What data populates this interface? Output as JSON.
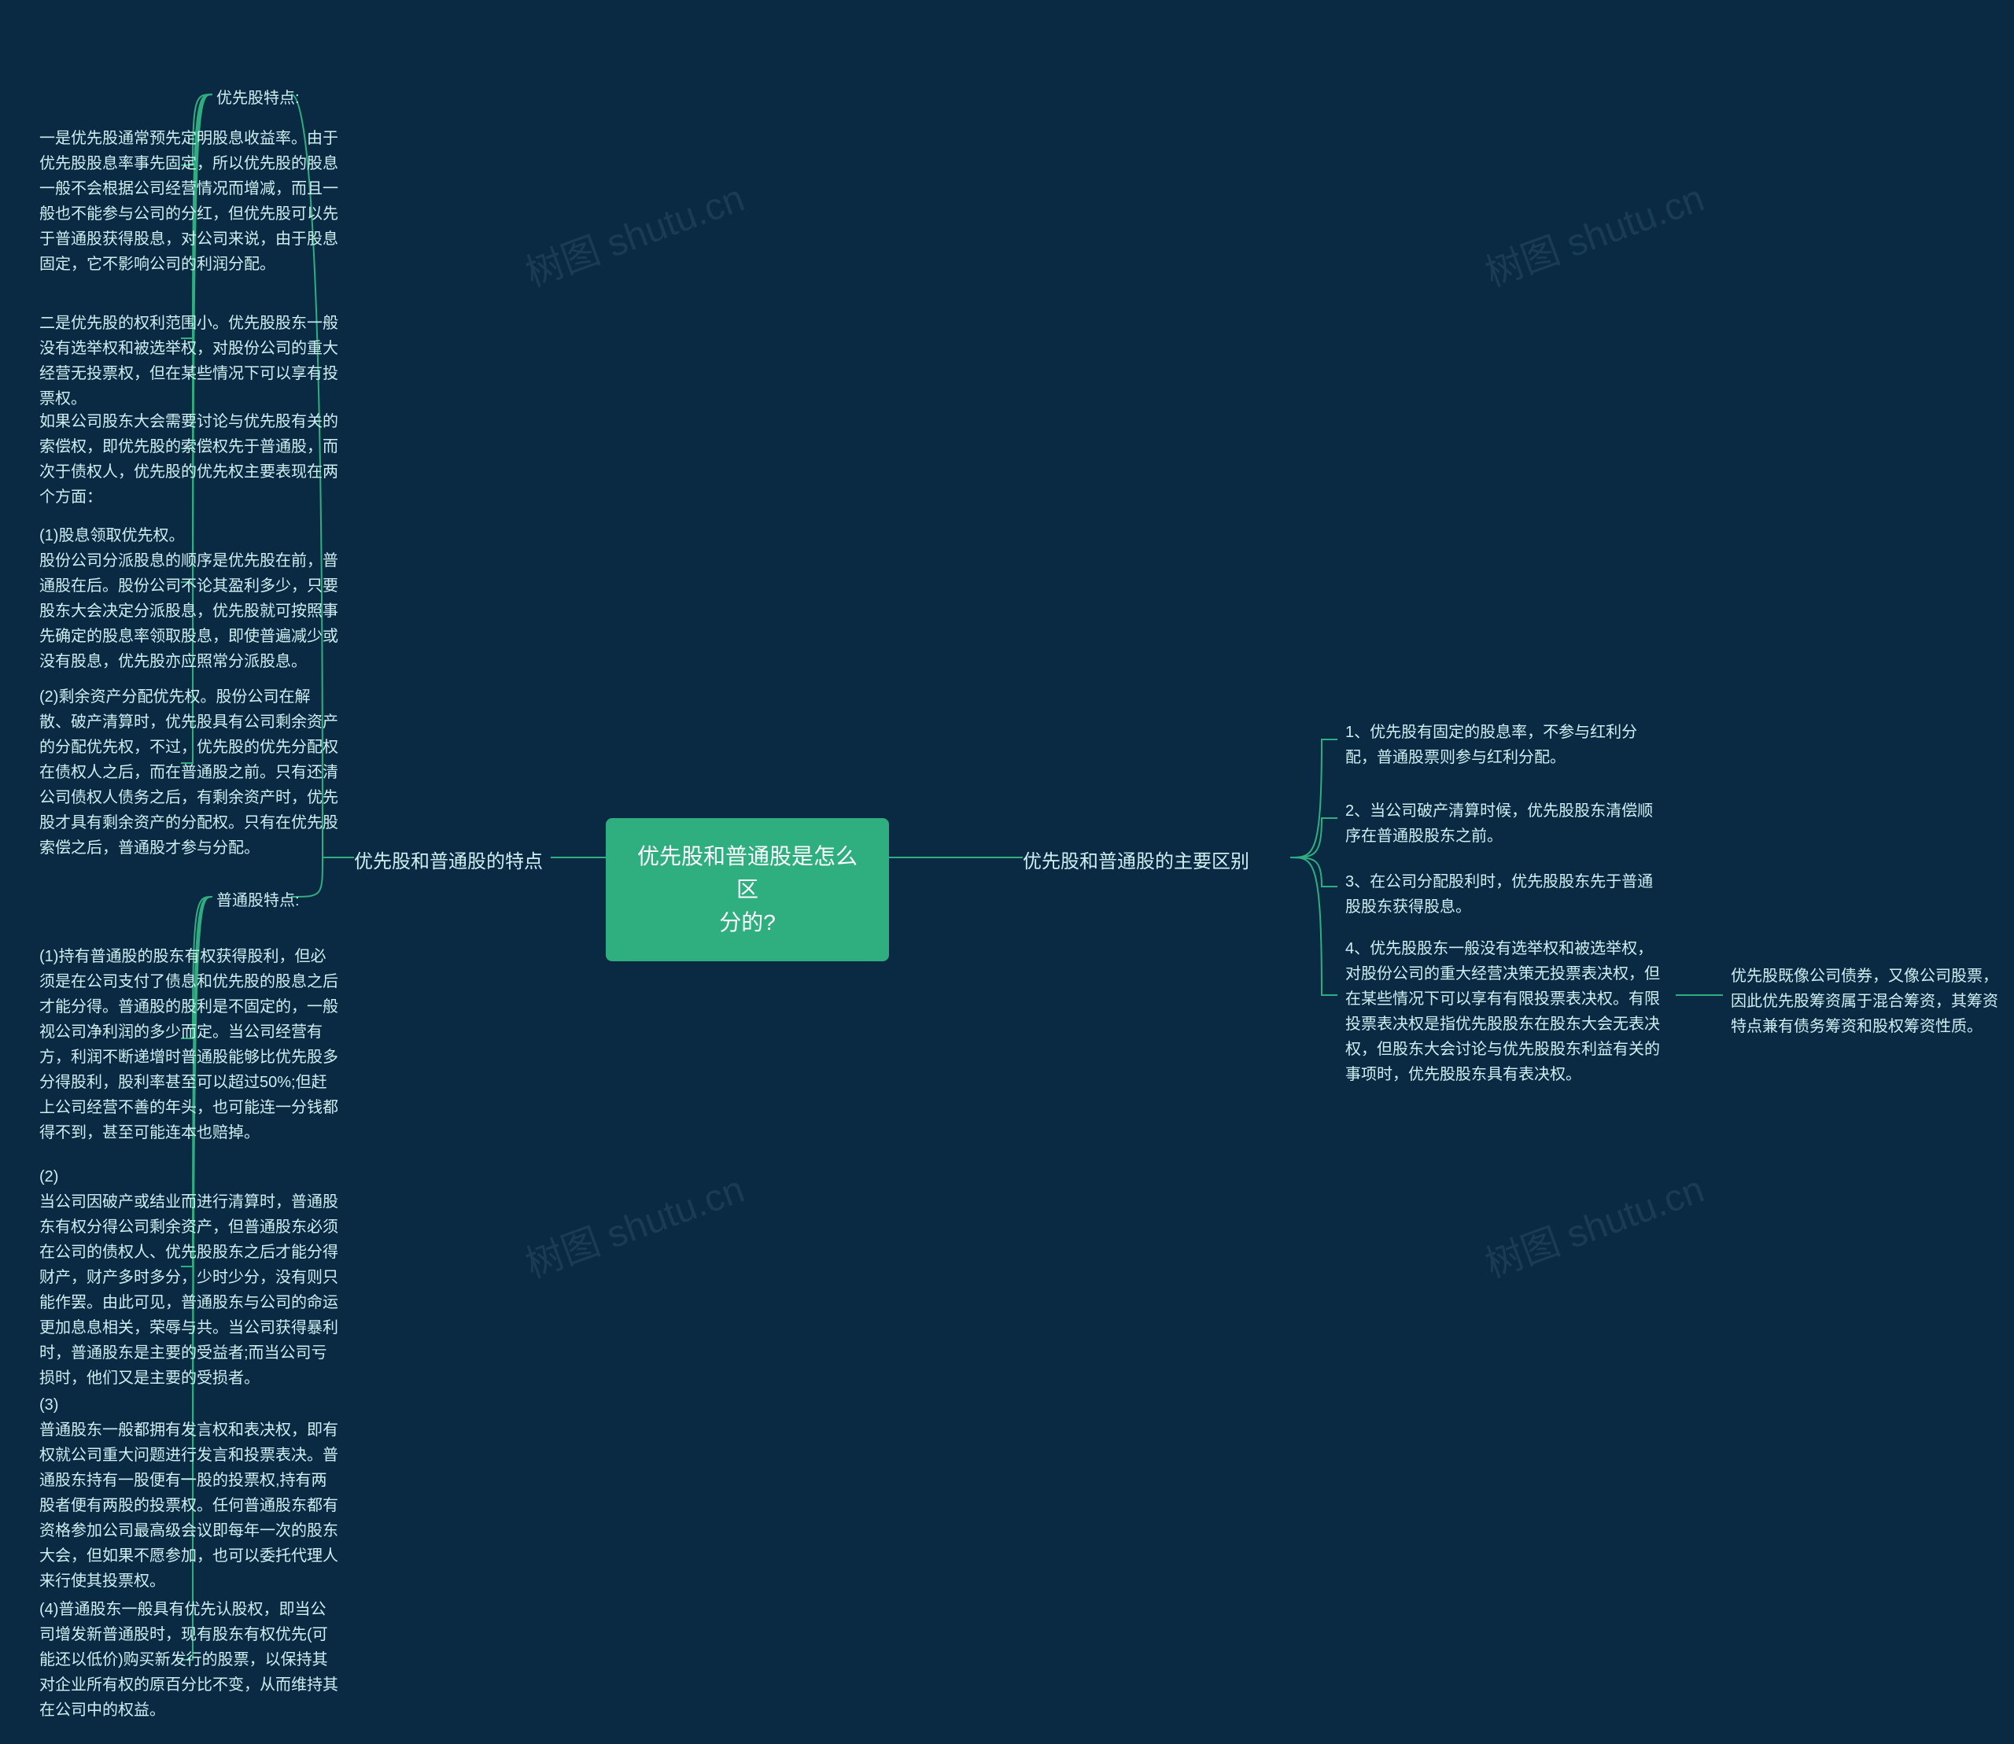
{
  "root": {
    "title": "优先股和普通股是怎么区\n分的?"
  },
  "watermarks": [
    "树图 shutu.cn",
    "树图 shutu.cn",
    "树图 shutu.cn",
    "树图 shutu.cn"
  ],
  "left_branch": {
    "label": "优先股和普通股的特点",
    "pref_label": "优先股特点:",
    "common_label": "普通股特点:",
    "pref_items": [
      "一是优先股通常预先定明股息收益率。由于优先股股息率事先固定，所以优先股的股息一般不会根据公司经营情况而增减，而且一般也不能参与公司的分红，但优先股可以先于普通股获得股息，对公司来说，由于股息固定，它不影响公司的利润分配。",
      "二是优先股的权利范围小。优先股股东一般没有选举权和被选举权，对股份公司的重大经营无投票权，但在某些情况下可以享有投票权。",
      "如果公司股东大会需要讨论与优先股有关的索偿权，即优先股的索偿权先于普通股，而次于债权人，优先股的优先权主要表现在两个方面：",
      "(1)股息领取优先权。\n股份公司分派股息的顺序是优先股在前，普通股在后。股份公司不论其盈利多少，只要股东大会决定分派股息，优先股就可按照事先确定的股息率领取股息，即使普遍减少或没有股息，优先股亦应照常分派股息。",
      "(2)剩余资产分配优先权。股份公司在解散、破产清算时，优先股具有公司剩余资产的分配优先权，不过，优先股的优先分配权在债权人之后，而在普通股之前。只有还清公司债权人债务之后，有剩余资产时，优先股才具有剩余资产的分配权。只有在优先股索偿之后，普通股才参与分配。"
    ],
    "common_items": [
      "(1)持有普通股的股东有权获得股利，但必须是在公司支付了债息和优先股的股息之后才能分得。普通股的股利是不固定的，一般视公司净利润的多少而定。当公司经营有方，利润不断递增时普通股能够比优先股多分得股利，股利率甚至可以超过50%;但赶上公司经营不善的年头，也可能连一分钱都得不到，甚至可能连本也赔掉。",
      "(2)\n当公司因破产或结业而进行清算时，普通股东有权分得公司剩余资产，但普通股东必须在公司的债权人、优先股股东之后才能分得财产，财产多时多分，少时少分，没有则只能作罢。由此可见，普通股东与公司的命运更加息息相关，荣辱与共。当公司获得暴利时，普通股东是主要的受益者;而当公司亏损时，他们又是主要的受损者。",
      "(3)\n普通股东一般都拥有发言权和表决权，即有权就公司重大问题进行发言和投票表决。普通股东持有一股便有一股的投票权,持有两股者便有两股的投票权。任何普通股东都有资格参加公司最高级会议即每年一次的股东大会，但如果不愿参加，也可以委托代理人来行使其投票权。",
      "(4)普通股东一般具有优先认股权，即当公司增发新普通股时，现有股东有权优先(可能还以低价)购买新发行的股票，以保持其对企业所有权的原百分比不变，从而维持其在公司中的权益。"
    ]
  },
  "right_branch": {
    "label": "优先股和普通股的主要区别",
    "items": [
      "1、优先股有固定的股息率，不参与红利分配，普通股票则参与红利分配。",
      "2、当公司破产清算时候，优先股股东清偿顺序在普通股股东之前。",
      "3、在公司分配股利时，优先股股东先于普通股股东获得股息。",
      "4、优先股股东一般没有选举权和被选举权，对股份公司的重大经营决策无投票表决权，但在某些情况下可以享有有限投票表决权。有限投票表决权是指优先股股东在股东大会无表决权，但股东大会讨论与优先股股东利益有关的事项时，优先股股东具有表决权。"
    ],
    "nested": "优先股既像公司债券，又像公司股票，因此优先股筹资属于混合筹资，其筹资特点兼有债务筹资和股权筹资性质。"
  }
}
